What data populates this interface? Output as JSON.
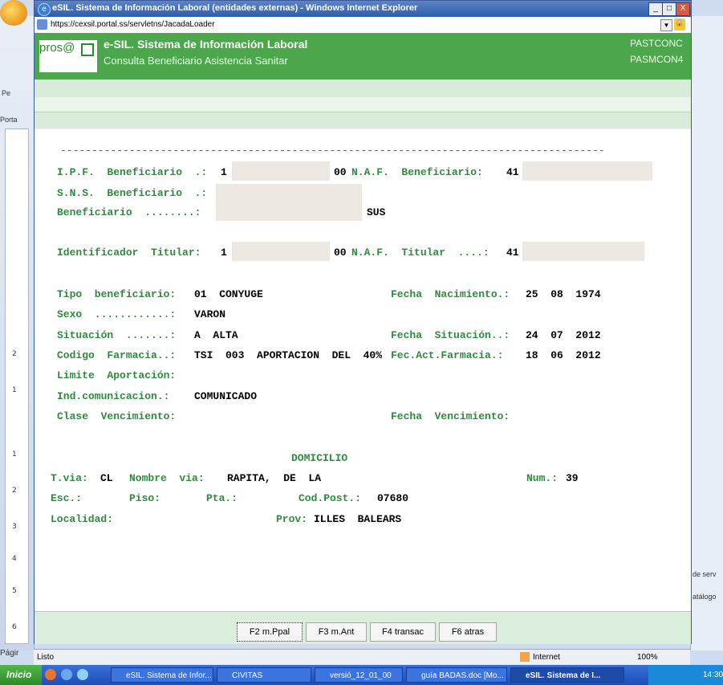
{
  "ie": {
    "title": "eSIL. Sistema de Información Laboral (entidades externas) - Windows Internet Explorer",
    "url": "https://cexsil.portal.ss/servletns/JacadaLoader",
    "buttons": {
      "minimize": "_",
      "maximize": "□",
      "close": "X"
    }
  },
  "background_app": {
    "pe": "Pe",
    "porta": "Porta",
    "l_button": "L",
    "page_label": "Págir",
    "right_text_1": "de serv",
    "right_text_2": "atálogo",
    "ruler_numbers": [
      "2",
      "1",
      "1",
      "2",
      "3",
      "4",
      "5",
      "6"
    ]
  },
  "header": {
    "logo": "pros@",
    "title": "e-SIL. Sistema de Información Laboral",
    "subtitle": "Consulta Beneficiario Asistencia Sanitar",
    "code1": "PASTCONC",
    "code2": "PASMCON4"
  },
  "form": {
    "dashes": "---------------------------------------------------------------------------------------",
    "ipf_label": "I.P.F.  Beneficiario  .:",
    "ipf_value": "1",
    "ipf_suffix": "00",
    "naf_label": "N.A.F.  Beneficiario:",
    "naf_value": "41",
    "sns_label": "S.N.S.  Beneficiario  .:",
    "benef_label": "Beneficiario  ........:",
    "benef_suffix": "SUS",
    "ident_label": "Identificador  Titular:",
    "ident_value": "1",
    "ident_suffix": "00",
    "naf_tit_label": "N.A.F.  Titular  ....:",
    "naf_tit_value": "41",
    "tipo_label": "Tipo  beneficiario:",
    "tipo_value": "01  CONYUGE",
    "fnac_label": "Fecha  Nacimiento.:",
    "fnac_value": "25  08  1974",
    "sexo_label": "Sexo  ............:",
    "sexo_value": "VARON",
    "sit_label": "Situación  .......:",
    "sit_value": "A  ALTA",
    "fsit_label": "Fecha  Situación..:",
    "fsit_value": "24  07  2012",
    "farm_label": "Codigo  Farmacia..:",
    "farm_value": "TSI  003  APORTACION  DEL  40%",
    "ffarm_label": "Fec.Act.Farmacia.:",
    "ffarm_value": "18  06  2012",
    "limite_label": "Limite  Aportación:",
    "indcom_label": "Ind.comunicacion.:",
    "indcom_value": "COMUNICADO",
    "clase_label": "Clase  Vencimiento:",
    "fvenc_label": "Fecha  Vencimiento:",
    "domicilio": "DOMICILIO",
    "tvia_label": "T.via:",
    "tvia_value": "CL",
    "nombre_label": "Nombre  via:",
    "nombre_value": "RAPITA,  DE  LA",
    "num_label": "Num.:",
    "num_value": "39",
    "esc_label": "Esc.:",
    "piso_label": "Piso:",
    "pta_label": "Pta.:",
    "cp_label": "Cod.Post.:",
    "cp_value": "07680",
    "loc_label": "Localidad:",
    "prov_label": "Prov:",
    "prov_value": "ILLES  BALEARS"
  },
  "footer": {
    "f2": "F2 m.Ppal",
    "f3": "F3 m.Ant",
    "f4": "F4 transac",
    "f6": "F6 atras"
  },
  "status": {
    "text": "Listo",
    "zone": "Internet",
    "zoom": "100%"
  },
  "taskbar": {
    "start": "Inicio",
    "item1": "eSIL. Sistema de Infor...",
    "item2": "CIVITAS",
    "item3": "versió_12_01_00",
    "item4": "guía BADAS.doc [Mo...",
    "item5": "eSIL. Sistema de I...",
    "clock": "14:30"
  },
  "colors": {
    "accent_green": "#4ca64c",
    "label_green": "#2e8b3e"
  }
}
